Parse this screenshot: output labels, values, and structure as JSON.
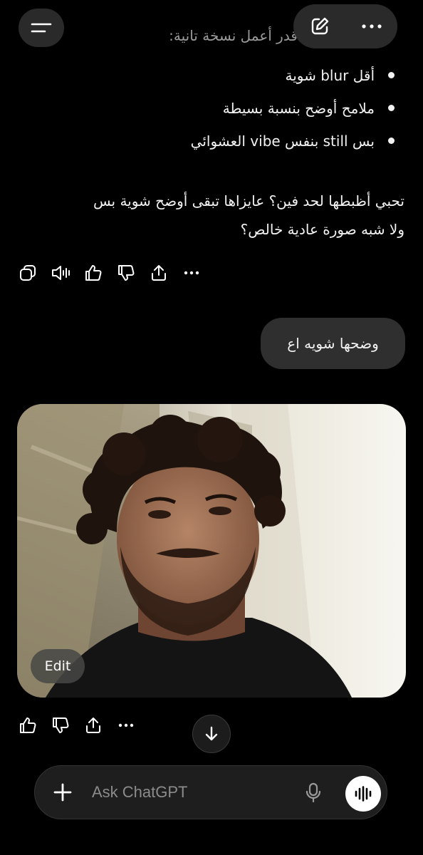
{
  "header": {
    "menu_icon": "hamburger-icon",
    "new_chat_icon": "edit-icon",
    "more_icon": "more-horizontal-icon"
  },
  "assistant_message": {
    "cut_off_line": "\"عايزاها\" أكتر، أقدر أعمل نسخة تانية:",
    "bullets": [
      "أقل blur شوية",
      "ملامح أوضح بنسبة بسيطة",
      "بس still بنفس vibe العشوائي"
    ],
    "question_line1": "تحبي أظبطها لحد فين؟ عايزاها تبقى أوضح شوية بس",
    "question_line2": "ولا شبه صورة عادية خالص؟",
    "actions": [
      "copy-icon",
      "speaker-icon",
      "thumbs-up-icon",
      "thumbs-down-icon",
      "share-icon",
      "more-horizontal-icon"
    ]
  },
  "user_message": {
    "text": "وضحها شويه اع"
  },
  "image_message": {
    "edit_label": "Edit",
    "actions": [
      "thumbs-up-icon",
      "thumbs-down-icon",
      "share-icon",
      "more-horizontal-icon"
    ]
  },
  "scroll_down_icon": "arrow-down-icon",
  "composer": {
    "placeholder": "Ask ChatGPT",
    "value": "",
    "plus_icon": "plus-icon",
    "mic_icon": "mic-icon",
    "voice_icon": "voice-mode-icon"
  }
}
